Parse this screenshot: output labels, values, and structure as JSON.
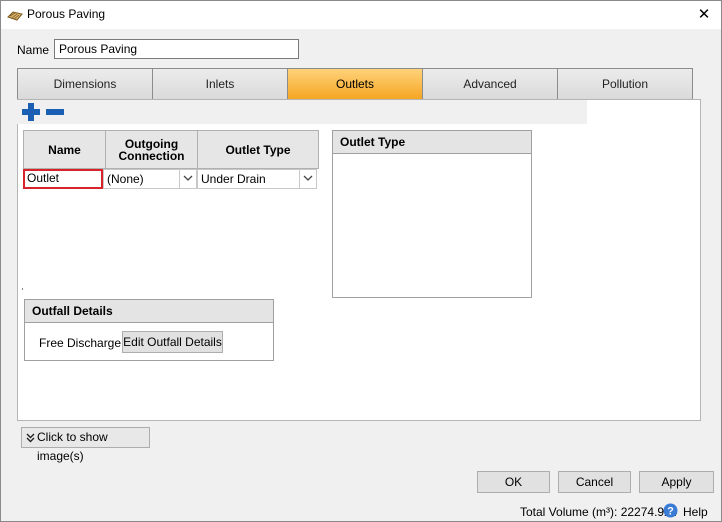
{
  "window": {
    "title": "Porous Paving",
    "icon": "paving-icon",
    "close_glyph": "✕"
  },
  "name_field": {
    "label": "Name",
    "value": "Porous Paving"
  },
  "tabs": [
    {
      "label": "Dimensions",
      "active": false
    },
    {
      "label": "Inlets",
      "active": false
    },
    {
      "label": "Outlets",
      "active": true
    },
    {
      "label": "Advanced",
      "active": false
    },
    {
      "label": "Pollution",
      "active": false
    }
  ],
  "toolbar": {
    "add_icon": "plus-icon",
    "remove_icon": "minus-icon"
  },
  "outlets_table": {
    "columns": [
      "Name",
      "Outgoing Connection",
      "Outlet Type"
    ],
    "rows": [
      {
        "name": "Outlet",
        "outgoing_connection": "(None)",
        "outlet_type": "Under Drain"
      }
    ]
  },
  "outlet_type_panel": {
    "title": "Outlet Type"
  },
  "outfall_details": {
    "title": "Outfall Details",
    "discharge_label": "Free Discharge",
    "edit_button": "Edit Outfall Details"
  },
  "show_images_button": "Click to show image(s)",
  "buttons": {
    "ok": "OK",
    "cancel": "Cancel",
    "apply": "Apply"
  },
  "status": {
    "total_volume": "Total Volume (m³): 22274.924",
    "help": "Help"
  },
  "colors": {
    "active_tab": "#f5a623",
    "accent_blue": "#1a5fb4",
    "selection_red": "#d9232a"
  }
}
